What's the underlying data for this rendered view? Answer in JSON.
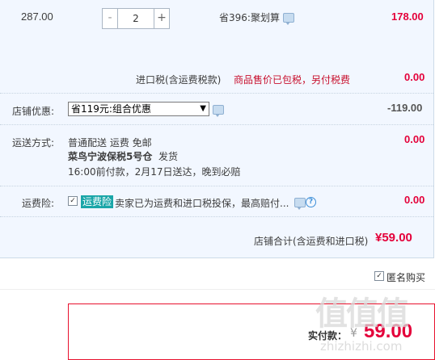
{
  "item_row": {
    "unit_price": "287.00",
    "quantity": "2",
    "minus_label": "-",
    "plus_label": "+",
    "promo": "省396:聚划算",
    "subtotal": "178.00"
  },
  "tax_row": {
    "label": "进口税(含运费税款)",
    "note": "商品售价已包税，另付税费",
    "amount": "0.00"
  },
  "discount_row": {
    "label": "店铺优惠:",
    "selected": "省119元:组合优惠",
    "amount": "-119.00"
  },
  "shipping_row": {
    "label": "运送方式:",
    "method": "普通配送 运费 免邮",
    "warehouse": "菜鸟宁波保税5号仓",
    "ship_note": "发货",
    "delivery": "16:00前付款，2月17日送达，晚到必赔",
    "amount": "0.00"
  },
  "insurance_row": {
    "label": "运费险:",
    "tag": "运费险",
    "desc": "卖家已为运费和进口税投保，最高赔付...",
    "amount": "0.00"
  },
  "total_row": {
    "label": "店铺合计(含运费和进口税)",
    "amount": "¥59.00"
  },
  "anonymous": {
    "label": "匿名购买",
    "checked": true
  },
  "payment": {
    "label": "实付款：",
    "currency": "¥",
    "amount": "59.00"
  },
  "watermark": {
    "logo": "值值值",
    "url": "zhizhizhi.com"
  },
  "colors": {
    "accent_red": "#e4003a",
    "panel_bg": "#f2f7ff",
    "tag_teal": "#1aa6a8"
  }
}
